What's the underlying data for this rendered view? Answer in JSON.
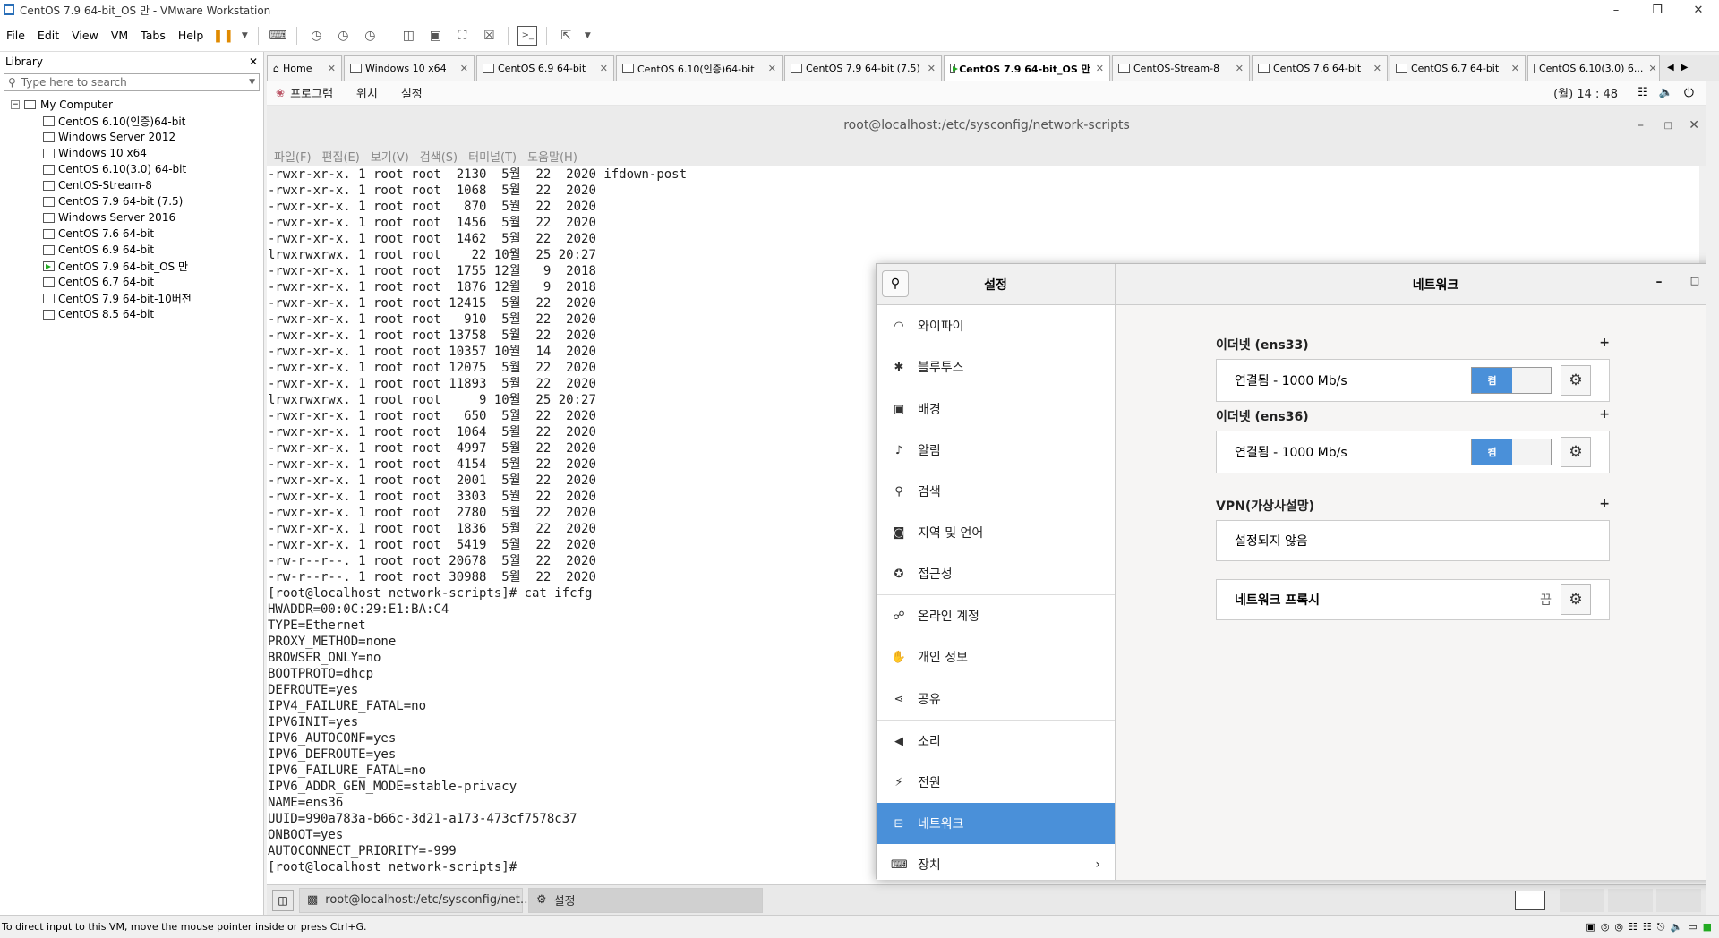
{
  "window": {
    "title": "CentOS 7.9 64-bit_OS 만 - VMware Workstation"
  },
  "menu": [
    "File",
    "Edit",
    "View",
    "VM",
    "Tabs",
    "Help"
  ],
  "library": {
    "header": "Library",
    "search_placeholder": "Type here to search",
    "root": "My Computer",
    "items": [
      "CentOS 6.10(인증)64-bit",
      "Windows Server 2012",
      "Windows 10 x64",
      "CentOS 6.10(3.0) 64-bit",
      "CentOS-Stream-8",
      "CentOS 7.9 64-bit (7.5)",
      "Windows Server 2016",
      "CentOS 7.6 64-bit",
      "CentOS 6.9 64-bit",
      "CentOS 7.9 64-bit_OS 만",
      "CentOS 6.7 64-bit",
      "CentOS 7.9 64-bit-10버전",
      "CentOS 8.5 64-bit"
    ]
  },
  "tabs": [
    "Home",
    "Windows 10 x64",
    "CentOS 6.9 64-bit",
    "CentOS 6.10(인증)64-bit",
    "CentOS 7.9 64-bit (7.5)",
    "CentOS 7.9 64-bit_OS 만",
    "CentOS-Stream-8",
    "CentOS 7.6 64-bit",
    "CentOS 6.7 64-bit",
    "CentOS 6.10(3.0) 6..."
  ],
  "guest_top": {
    "menus": [
      "프로그램",
      "위치",
      "설정"
    ],
    "clock": "(월) 14 : 48"
  },
  "terminal": {
    "title": "root@localhost:/etc/sysconfig/network-scripts",
    "menus": [
      "파일(F)",
      "편집(E)",
      "보기(V)",
      "검색(S)",
      "터미널(T)",
      "도움말(H)"
    ],
    "lines": [
      "-rwxr-xr-x. 1 root root  2130  5월  22  2020 ifdown-post",
      "-rwxr-xr-x. 1 root root  1068  5월  22  2020",
      "-rwxr-xr-x. 1 root root   870  5월  22  2020",
      "-rwxr-xr-x. 1 root root  1456  5월  22  2020",
      "-rwxr-xr-x. 1 root root  1462  5월  22  2020",
      "lrwxrwxrwx. 1 root root    22 10월  25 20:27",
      "-rwxr-xr-x. 1 root root  1755 12월   9  2018",
      "-rwxr-xr-x. 1 root root  1876 12월   9  2018",
      "-rwxr-xr-x. 1 root root 12415  5월  22  2020",
      "-rwxr-xr-x. 1 root root   910  5월  22  2020",
      "-rwxr-xr-x. 1 root root 13758  5월  22  2020",
      "-rwxr-xr-x. 1 root root 10357 10월  14  2020",
      "-rwxr-xr-x. 1 root root 12075  5월  22  2020",
      "-rwxr-xr-x. 1 root root 11893  5월  22  2020",
      "lrwxrwxrwx. 1 root root     9 10월  25 20:27",
      "-rwxr-xr-x. 1 root root   650  5월  22  2020",
      "-rwxr-xr-x. 1 root root  1064  5월  22  2020",
      "-rwxr-xr-x. 1 root root  4997  5월  22  2020",
      "-rwxr-xr-x. 1 root root  4154  5월  22  2020",
      "-rwxr-xr-x. 1 root root  2001  5월  22  2020",
      "-rwxr-xr-x. 1 root root  3303  5월  22  2020",
      "-rwxr-xr-x. 1 root root  2780  5월  22  2020",
      "-rwxr-xr-x. 1 root root  1836  5월  22  2020",
      "-rwxr-xr-x. 1 root root  5419  5월  22  2020",
      "-rw-r--r--. 1 root root 20678  5월  22  2020",
      "-rw-r--r--. 1 root root 30988  5월  22  2020",
      "[root@localhost network-scripts]# cat ifcfg",
      "HWADDR=00:0C:29:E1:BA:C4",
      "TYPE=Ethernet",
      "PROXY_METHOD=none",
      "BROWSER_ONLY=no",
      "BOOTPROTO=dhcp",
      "DEFROUTE=yes",
      "IPV4_FAILURE_FATAL=no",
      "IPV6INIT=yes",
      "IPV6_AUTOCONF=yes",
      "IPV6_DEFROUTE=yes",
      "IPV6_FAILURE_FATAL=no",
      "IPV6_ADDR_GEN_MODE=stable-privacy",
      "NAME=ens36",
      "UUID=990a783a-b66c-3d21-a173-473cf7578c37",
      "ONBOOT=yes",
      "AUTOCONNECT_PRIORITY=-999",
      "[root@localhost network-scripts]# "
    ]
  },
  "settings": {
    "title": "설정",
    "sidebar": [
      {
        "label": "와이파이",
        "icon": "wifi-icon",
        "glyph": "◠"
      },
      {
        "label": "블루투스",
        "icon": "bluetooth-icon",
        "glyph": "✱"
      },
      {
        "label": "배경",
        "icon": "background-icon",
        "glyph": "▣"
      },
      {
        "label": "알림",
        "icon": "bell-icon",
        "glyph": "♪"
      },
      {
        "label": "검색",
        "icon": "search-icon",
        "glyph": "⚲"
      },
      {
        "label": "지역 및 언어",
        "icon": "camera-icon",
        "glyph": "◙"
      },
      {
        "label": "접근성",
        "icon": "accessibility-icon",
        "glyph": "✪"
      },
      {
        "label": "온라인 계정",
        "icon": "online-accounts-icon",
        "glyph": "☍"
      },
      {
        "label": "개인 정보",
        "icon": "privacy-hand-icon",
        "glyph": "✋"
      },
      {
        "label": "공유",
        "icon": "share-icon",
        "glyph": "⋖"
      },
      {
        "label": "소리",
        "icon": "speaker-icon",
        "glyph": "◀"
      },
      {
        "label": "전원",
        "icon": "power-icon",
        "glyph": "⚡"
      },
      {
        "label": "네트워크",
        "icon": "network-icon",
        "glyph": "⊟",
        "selected": true
      },
      {
        "label": "장치",
        "icon": "devices-icon",
        "glyph": "⌨"
      }
    ],
    "network": {
      "title": "네트워크",
      "eth1": {
        "title": "이더넷 (ens33)",
        "status": "연결됨 - 1000 Mb/s",
        "toggle": "켬"
      },
      "eth2": {
        "title": "이더넷 (ens36)",
        "status": "연결됨 - 1000 Mb/s",
        "toggle": "켬"
      },
      "vpn": {
        "title": "VPN(가상사설망)",
        "status": "설정되지 않음"
      },
      "proxy": {
        "title": "네트워크 프록시",
        "value": "끔"
      }
    }
  },
  "guest_taskbar": {
    "terminal": "root@localhost:/etc/sysconfig/net…",
    "settings": "설정"
  },
  "statusbar": {
    "text": "To direct input to this VM, move the mouse pointer inside or press Ctrl+G."
  },
  "colors": {
    "accent": "#4a90d9"
  }
}
